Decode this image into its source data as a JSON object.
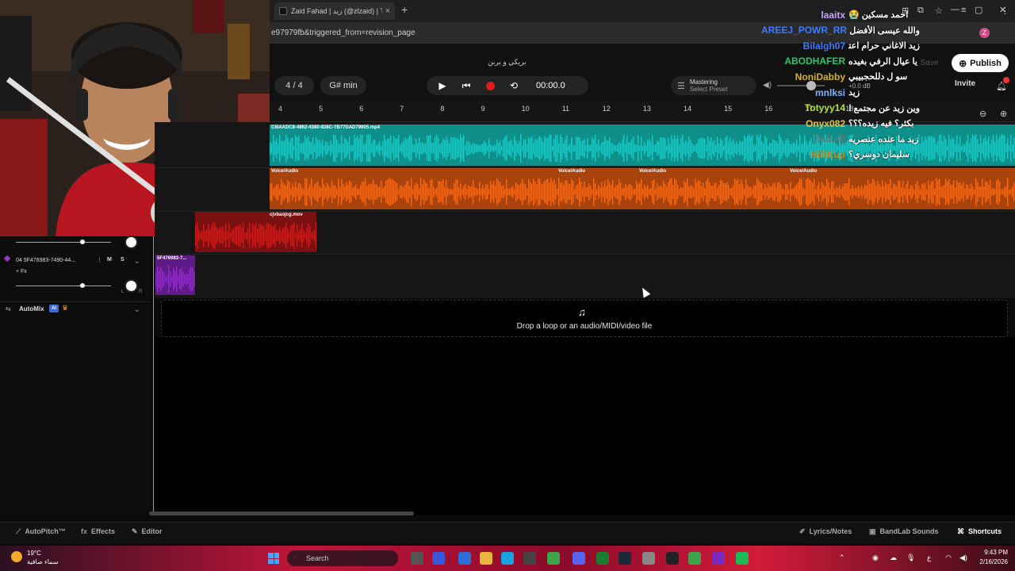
{
  "browser": {
    "tab_title": "Zaid Fahad | زيد (@zlzaid) | TikT",
    "tab_close": "×",
    "new_tab": "+",
    "url": "e97979fb&triggered_from=revision_page",
    "profile_initial": "Z"
  },
  "daw": {
    "song_title": "بريكي و بربن",
    "time_signature": "4 / 4",
    "key": "G# min",
    "time": "00:00.0",
    "mastering_title": "Mastering",
    "mastering_subtitle": "Select Preset",
    "db_readout": "+0.0 dB",
    "save_label": "Save",
    "publish_label": "Publish",
    "invite_label": "Invite",
    "ruler_ticks": [
      "4",
      "5",
      "6",
      "7",
      "8",
      "9",
      "10",
      "11",
      "12",
      "13",
      "14",
      "15",
      "16",
      "17",
      "18"
    ],
    "clips": {
      "teal_label": "C6IAADC8-4862-4380-838C-7B77DAD79905.mp4",
      "orange_label": "Voice/Audio",
      "orange_label_2": "Voice/Audio",
      "orange_label_3": "Voice/Audio",
      "orange_label_4": "Voice/Audio",
      "red_label": "cjvbaojcg.mov",
      "purple_label": "5F476983-7..."
    },
    "track": {
      "name": "04  5F476983-7490-44...",
      "fx": "+ Fx",
      "mute": "M",
      "solo": "S",
      "pan_l": "L",
      "pan_r": "R"
    },
    "automix_label": "AutoMix",
    "ai_badge": "AI",
    "drop_text": "Drop a loop or an audio/MIDI/video file",
    "colors": {
      "teal": "#21c7c2",
      "orange": "#f26a1b",
      "red": "#c41e1e",
      "purple": "#8e2fc4"
    }
  },
  "bottom_bar": {
    "autopitch": "AutoPitch™",
    "effects": "Effects",
    "editor": "Editor",
    "lyrics": "Lyrics/Notes",
    "sounds": "BandLab Sounds",
    "shortcuts": "Shortcuts"
  },
  "taskbar": {
    "temperature": "19°C",
    "condition": "سماء صافية",
    "search_placeholder": "Search",
    "language": "ع",
    "time": "9:43 PM",
    "date": "2/16/2026"
  },
  "chat": [
    {
      "user": "laaitx",
      "msg": "احمد مسكين 😭",
      "color": "#c6a3ff"
    },
    {
      "user": "AREEJ_POWR_RR",
      "msg": "والله عيسى الأفضل",
      "color": "#3d7bff"
    },
    {
      "user": "Bilalgh07",
      "msg": "زيد الاغاني حرام اعتزل",
      "color": "#3d7bff"
    },
    {
      "user": "ABODHAFER",
      "msg": "يا عيال الرفي بغيده",
      "color": "#2ec46b"
    },
    {
      "user": "NoniDabby",
      "msg": "سو ل دللحجبيبي",
      "color": "#d4b21a"
    },
    {
      "user": "mnlksi",
      "msg": "زيد",
      "color": "#7fb2ff"
    },
    {
      "user": "Totyyy14",
      "msg": "وين زيد عن مجتمع الزيززززززز",
      "color": "#b7e23a"
    },
    {
      "user": "Onyx082",
      "msg": "بكثر؟ فيه زيده؟؟؟",
      "color": "#e0c23a"
    },
    {
      "user": "[faded]",
      "msg": "زيد ما عنده عنصريه",
      "color": "#5a7a7a"
    },
    {
      "user": "HiRKup",
      "msg": "سليمان دوسري؟",
      "color": "#c98a1a"
    }
  ]
}
